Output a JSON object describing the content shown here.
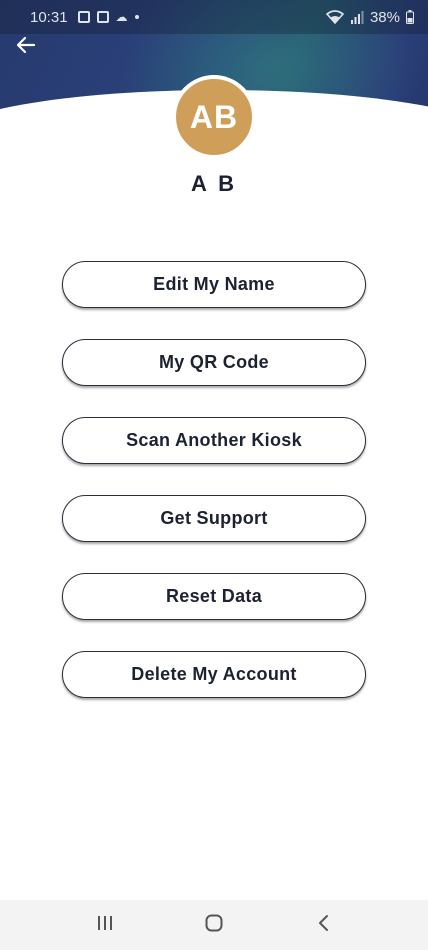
{
  "status_bar": {
    "time": "10:31",
    "battery": "38%"
  },
  "header": {
    "back_icon": "arrow-left-icon"
  },
  "profile": {
    "initials": "AB",
    "name": "A B",
    "avatar_color": "#cf9f5a"
  },
  "menu": {
    "items": [
      {
        "label": "Edit My Name"
      },
      {
        "label": "My QR Code"
      },
      {
        "label": "Scan Another Kiosk"
      },
      {
        "label": "Get Support"
      },
      {
        "label": "Reset Data"
      },
      {
        "label": "Delete My Account"
      }
    ]
  },
  "nav_bar": {
    "recent_icon": "recent-apps-icon",
    "home_icon": "home-icon",
    "back_icon": "nav-back-icon"
  },
  "colors": {
    "header_navy": "#263a6e",
    "text_dark": "#1c2232"
  }
}
